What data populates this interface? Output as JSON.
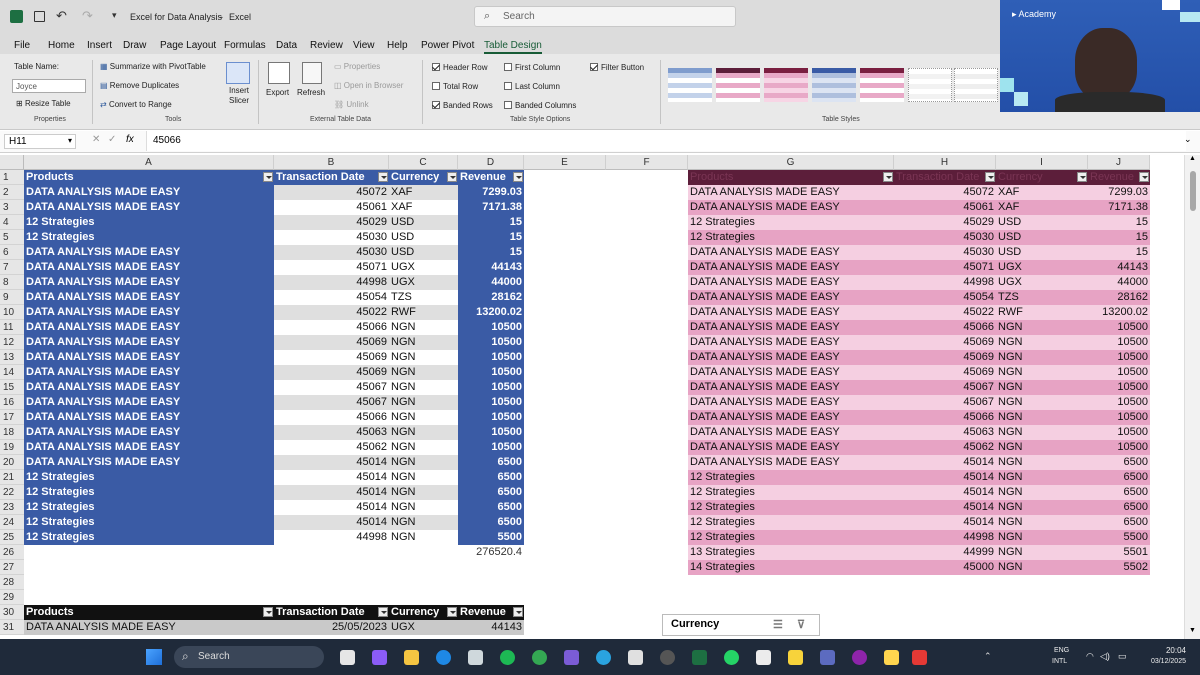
{
  "titlebar": {
    "doc_title": "Excel for Data Analysis",
    "app": "Excel",
    "search_placeholder": "Search"
  },
  "menu": [
    "File",
    "Home",
    "Insert",
    "Draw",
    "Page Layout",
    "Formulas",
    "Data",
    "Review",
    "View",
    "Help",
    "Power Pivot",
    "Table Design"
  ],
  "menu_active": "Table Design",
  "ribbon": {
    "table_name_label": "Table Name:",
    "table_name_value": "Joyce",
    "resize_table": "Resize Table",
    "group_properties": "Properties",
    "summarize_pivot": "Summarize with PivotTable",
    "remove_duplicates": "Remove Duplicates",
    "convert_to_range": "Convert to Range",
    "group_tools": "Tools",
    "insert_slicer": "Insert Slicer",
    "export": "Export",
    "refresh": "Refresh",
    "properties": "Properties",
    "open_in_browser": "Open in Browser",
    "unlink": "Unlink",
    "group_external": "External Table Data",
    "header_row": "Header Row",
    "total_row": "Total Row",
    "banded_rows": "Banded Rows",
    "first_column": "First Column",
    "last_column": "Last Column",
    "banded_columns": "Banded Columns",
    "filter_button": "Filter Button",
    "group_style_options": "Table Style Options",
    "group_table_styles": "Table Styles"
  },
  "video": {
    "label": "Academy"
  },
  "formula_bar": {
    "name_box": "H11",
    "fx": "fx",
    "value": "45066"
  },
  "columns": [
    "A",
    "B",
    "C",
    "D",
    "E",
    "F",
    "G",
    "H",
    "I",
    "J"
  ],
  "table1": {
    "headers": [
      "Products",
      "Transaction Date",
      "Currency",
      "Revenue"
    ],
    "rows": [
      [
        "DATA ANALYSIS MADE EASY",
        "45072",
        "XAF",
        "7299.03"
      ],
      [
        "DATA ANALYSIS MADE EASY",
        "45061",
        "XAF",
        "7171.38"
      ],
      [
        "12 Strategies",
        "45029",
        "USD",
        "15"
      ],
      [
        "12 Strategies",
        "45030",
        "USD",
        "15"
      ],
      [
        "DATA ANALYSIS MADE EASY",
        "45030",
        "USD",
        "15"
      ],
      [
        "DATA ANALYSIS MADE EASY",
        "45071",
        "UGX",
        "44143"
      ],
      [
        "DATA ANALYSIS MADE EASY",
        "44998",
        "UGX",
        "44000"
      ],
      [
        "DATA ANALYSIS MADE EASY",
        "45054",
        "TZS",
        "28162"
      ],
      [
        "DATA ANALYSIS MADE EASY",
        "45022",
        "RWF",
        "13200.02"
      ],
      [
        "DATA ANALYSIS MADE EASY",
        "45066",
        "NGN",
        "10500"
      ],
      [
        "DATA ANALYSIS MADE EASY",
        "45069",
        "NGN",
        "10500"
      ],
      [
        "DATA ANALYSIS MADE EASY",
        "45069",
        "NGN",
        "10500"
      ],
      [
        "DATA ANALYSIS MADE EASY",
        "45069",
        "NGN",
        "10500"
      ],
      [
        "DATA ANALYSIS MADE EASY",
        "45067",
        "NGN",
        "10500"
      ],
      [
        "DATA ANALYSIS MADE EASY",
        "45067",
        "NGN",
        "10500"
      ],
      [
        "DATA ANALYSIS MADE EASY",
        "45066",
        "NGN",
        "10500"
      ],
      [
        "DATA ANALYSIS MADE EASY",
        "45063",
        "NGN",
        "10500"
      ],
      [
        "DATA ANALYSIS MADE EASY",
        "45062",
        "NGN",
        "10500"
      ],
      [
        "DATA ANALYSIS MADE EASY",
        "45014",
        "NGN",
        "6500"
      ],
      [
        "12 Strategies",
        "45014",
        "NGN",
        "6500"
      ],
      [
        "12 Strategies",
        "45014",
        "NGN",
        "6500"
      ],
      [
        "12 Strategies",
        "45014",
        "NGN",
        "6500"
      ],
      [
        "12 Strategies",
        "45014",
        "NGN",
        "6500"
      ],
      [
        "12 Strategies",
        "44998",
        "NGN",
        "5500"
      ]
    ],
    "total": "276520.4"
  },
  "table2": {
    "headers": [
      "Products",
      "Transaction Date",
      "Currency",
      "Revenue"
    ],
    "rows": [
      [
        "DATA ANALYSIS MADE EASY",
        "45072",
        "XAF",
        "7299.03"
      ],
      [
        "DATA ANALYSIS MADE EASY",
        "45061",
        "XAF",
        "7171.38"
      ],
      [
        "12 Strategies",
        "45029",
        "USD",
        "15"
      ],
      [
        "12 Strategies",
        "45030",
        "USD",
        "15"
      ],
      [
        "DATA ANALYSIS MADE EASY",
        "45030",
        "USD",
        "15"
      ],
      [
        "DATA ANALYSIS MADE EASY",
        "45071",
        "UGX",
        "44143"
      ],
      [
        "DATA ANALYSIS MADE EASY",
        "44998",
        "UGX",
        "44000"
      ],
      [
        "DATA ANALYSIS MADE EASY",
        "45054",
        "TZS",
        "28162"
      ],
      [
        "DATA ANALYSIS MADE EASY",
        "45022",
        "RWF",
        "13200.02"
      ],
      [
        "DATA ANALYSIS MADE EASY",
        "45066",
        "NGN",
        "10500"
      ],
      [
        "DATA ANALYSIS MADE EASY",
        "45069",
        "NGN",
        "10500"
      ],
      [
        "DATA ANALYSIS MADE EASY",
        "45069",
        "NGN",
        "10500"
      ],
      [
        "DATA ANALYSIS MADE EASY",
        "45069",
        "NGN",
        "10500"
      ],
      [
        "DATA ANALYSIS MADE EASY",
        "45067",
        "NGN",
        "10500"
      ],
      [
        "DATA ANALYSIS MADE EASY",
        "45067",
        "NGN",
        "10500"
      ],
      [
        "DATA ANALYSIS MADE EASY",
        "45066",
        "NGN",
        "10500"
      ],
      [
        "DATA ANALYSIS MADE EASY",
        "45063",
        "NGN",
        "10500"
      ],
      [
        "DATA ANALYSIS MADE EASY",
        "45062",
        "NGN",
        "10500"
      ],
      [
        "DATA ANALYSIS MADE EASY",
        "45014",
        "NGN",
        "6500"
      ],
      [
        "12 Strategies",
        "45014",
        "NGN",
        "6500"
      ],
      [
        "12 Strategies",
        "45014",
        "NGN",
        "6500"
      ],
      [
        "12 Strategies",
        "45014",
        "NGN",
        "6500"
      ],
      [
        "12 Strategies",
        "45014",
        "NGN",
        "6500"
      ],
      [
        "12 Strategies",
        "44998",
        "NGN",
        "5500"
      ],
      [
        "13 Strategies",
        "44999",
        "NGN",
        "5501"
      ],
      [
        "14 Strategies",
        "45000",
        "NGN",
        "5502"
      ]
    ]
  },
  "table3": {
    "headers": [
      "Products",
      "Transaction Date",
      "Currency",
      "Revenue"
    ],
    "first_row": [
      "DATA ANALYSIS MADE EASY",
      "25/05/2023",
      "UGX",
      "44143"
    ]
  },
  "slicer": {
    "title": "Currency"
  },
  "taskbar": {
    "search": "Search",
    "lang1": "ENG",
    "lang2": "INTL",
    "time": "20:04",
    "date": "03/12/2025"
  },
  "colors": {
    "table1_blue": "#3a5ba5",
    "table2_dark": "#5c1e3a",
    "table2_band1": "#e7a3c4",
    "table2_band2": "#f5cfe1",
    "excel_green": "#185c37"
  }
}
